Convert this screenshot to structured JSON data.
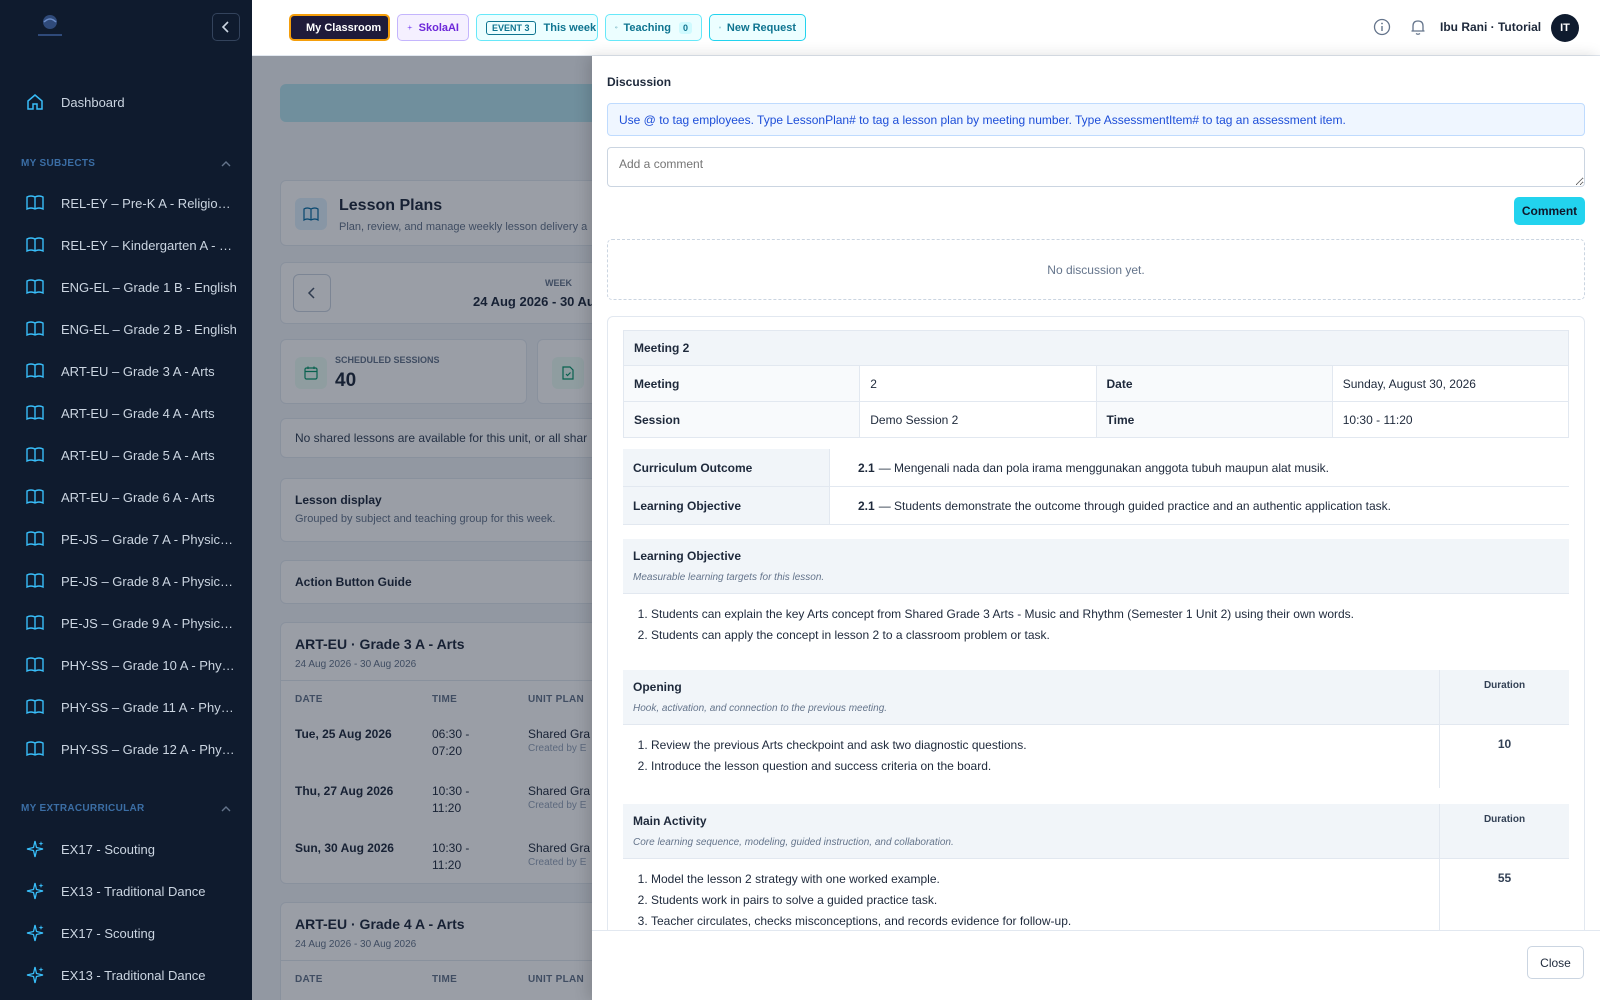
{
  "sidebar": {
    "dashboard": "Dashboard",
    "subjects_header": "MY SUBJECTS",
    "subjects": [
      "REL-EY – Pre-K A - Religious a...",
      "REL-EY – Kindergarten A - Reli...",
      "ENG-EL – Grade 1 B - English",
      "ENG-EL – Grade 2 B - English",
      "ART-EU – Grade 3 A - Arts",
      "ART-EU – Grade 4 A - Arts",
      "ART-EU – Grade 5 A - Arts",
      "ART-EU – Grade 6 A - Arts",
      "PE-JS – Grade 7 A - Physical E...",
      "PE-JS – Grade 8 A - Physical E...",
      "PE-JS – Grade 9 A - Physical E...",
      "PHY-SS – Grade 10 A - Physics",
      "PHY-SS – Grade 11 A - Physics",
      "PHY-SS – Grade 12 A - Physics"
    ],
    "extra_header": "MY EXTRACURRICULAR",
    "extras": [
      "EX17 - Scouting",
      "EX13 - Traditional Dance",
      "EX17 - Scouting",
      "EX13 - Traditional Dance"
    ]
  },
  "topbar": {
    "my_classroom": "My Classroom",
    "skolaai": "SkolaAI",
    "event_tag": "EVENT 3",
    "event_label": "This week",
    "teaching": "Teaching",
    "teaching_count": "0",
    "new_request": "New Request",
    "user": "Ibu Rani · Tutorial",
    "avatar": "IT"
  },
  "background": {
    "title": "Lesson Plans",
    "subtitle": "Plan, review, and manage weekly lesson delivery a",
    "week_label": "WEEK",
    "week_value": "24 Aug 2026 - 30 Au",
    "scheduled_label": "SCHEDULED SESSIONS",
    "scheduled_value": "40",
    "no_shared": "No shared lessons are available for this unit, or all shar",
    "display_title": "Lesson display",
    "display_sub": "Grouped by subject and teaching group for this week.",
    "guide": "Action Button Guide",
    "group1_title": "ART-EU · Grade 3 A - Arts",
    "group1_range": "24 Aug 2026 - 30 Aug 2026",
    "columns": [
      "DATE",
      "TIME",
      "UNIT PLAN"
    ],
    "rows": [
      {
        "date": "Tue, 25 Aug 2026",
        "time1": "06:30 -",
        "time2": "07:20",
        "unit": "Shared Gra",
        "created": "Created by E"
      },
      {
        "date": "Thu, 27 Aug 2026",
        "time1": "10:30 -",
        "time2": "11:20",
        "unit": "Shared Gra",
        "created": "Created by E"
      },
      {
        "date": "Sun, 30 Aug 2026",
        "time1": "10:30 -",
        "time2": "11:20",
        "unit": "Shared Gra",
        "created": "Created by E"
      }
    ],
    "group2_title": "ART-EU · Grade 4 A - Arts",
    "group2_range": "24 Aug 2026 - 30 Aug 2026"
  },
  "drawer": {
    "discussion_title": "Discussion",
    "hint": "Use @ to tag employees. Type LessonPlan# to tag a lesson plan by meeting number. Type AssessmentItem# to tag an assessment item.",
    "comment_placeholder": "Add a comment",
    "comment_button": "Comment",
    "no_discussion": "No discussion yet.",
    "meeting_header": "Meeting 2",
    "meeting_label": "Meeting",
    "meeting_value": "2",
    "date_label": "Date",
    "date_value": "Sunday, August 30, 2026",
    "session_label": "Session",
    "session_value": "Demo Session 2",
    "time_label": "Time",
    "time_value": "10:30 - 11:20",
    "outcome_label": "Curriculum Outcome",
    "outcome_code": "2.1",
    "outcome_text": "— Mengenali nada dan pola irama menggunakan anggota tubuh maupun alat musik.",
    "objective_label": "Learning Objective",
    "objective_code": "2.1",
    "objective_text": "— Students demonstrate the outcome through guided practice and an authentic application task.",
    "lo_title": "Learning Objective",
    "lo_desc": "Measurable learning targets for this lesson.",
    "lo_items": [
      "Students can explain the key Arts concept from Shared Grade 3 Arts - Music and Rhythm (Semester 1 Unit 2) using their own words.",
      "Students can apply the concept in lesson 2 to a classroom problem or task."
    ],
    "opening_title": "Opening",
    "opening_desc": "Hook, activation, and connection to the previous meeting.",
    "duration_label": "Duration",
    "opening_duration": "10",
    "opening_items": [
      "Review the previous Arts checkpoint and ask two diagnostic questions.",
      "Introduce the lesson question and success criteria on the board."
    ],
    "main_title": "Main Activity",
    "main_desc": "Core learning sequence, modeling, guided instruction, and collaboration.",
    "main_duration": "55",
    "main_items": [
      "Model the lesson 2 strategy with one worked example.",
      "Students work in pairs to solve a guided practice task.",
      "Teacher circulates, checks misconceptions, and records evidence for follow-up."
    ],
    "close_button": "Close"
  }
}
